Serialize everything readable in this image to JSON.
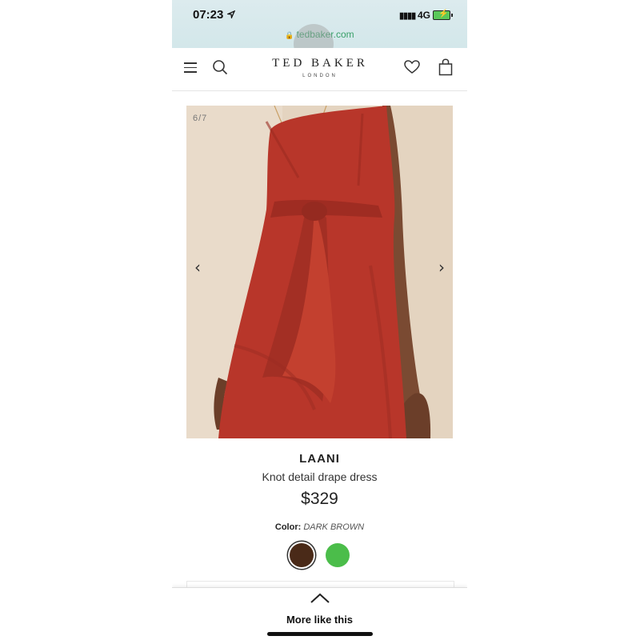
{
  "status": {
    "time": "07:23",
    "network": "4G"
  },
  "browser": {
    "url": "tedbaker.com"
  },
  "header": {
    "logo_main": "TED BAKER",
    "logo_sub": "LONDON"
  },
  "gallery": {
    "counter": "6/7",
    "current": 6,
    "total": 7
  },
  "product": {
    "name": "LAANI",
    "description": "Knot detail drape dress",
    "price": "$329",
    "color_label": "Color:",
    "color_value": "DARK BROWN",
    "swatches": [
      {
        "name": "dark-brown",
        "hex": "#4a2a18",
        "selected": true
      },
      {
        "name": "green",
        "hex": "#4bbd4a",
        "selected": false
      }
    ]
  },
  "footer": {
    "more_label": "More like this"
  },
  "colors": {
    "url_green": "#3aa06a",
    "dress_red": "#b8362a"
  }
}
